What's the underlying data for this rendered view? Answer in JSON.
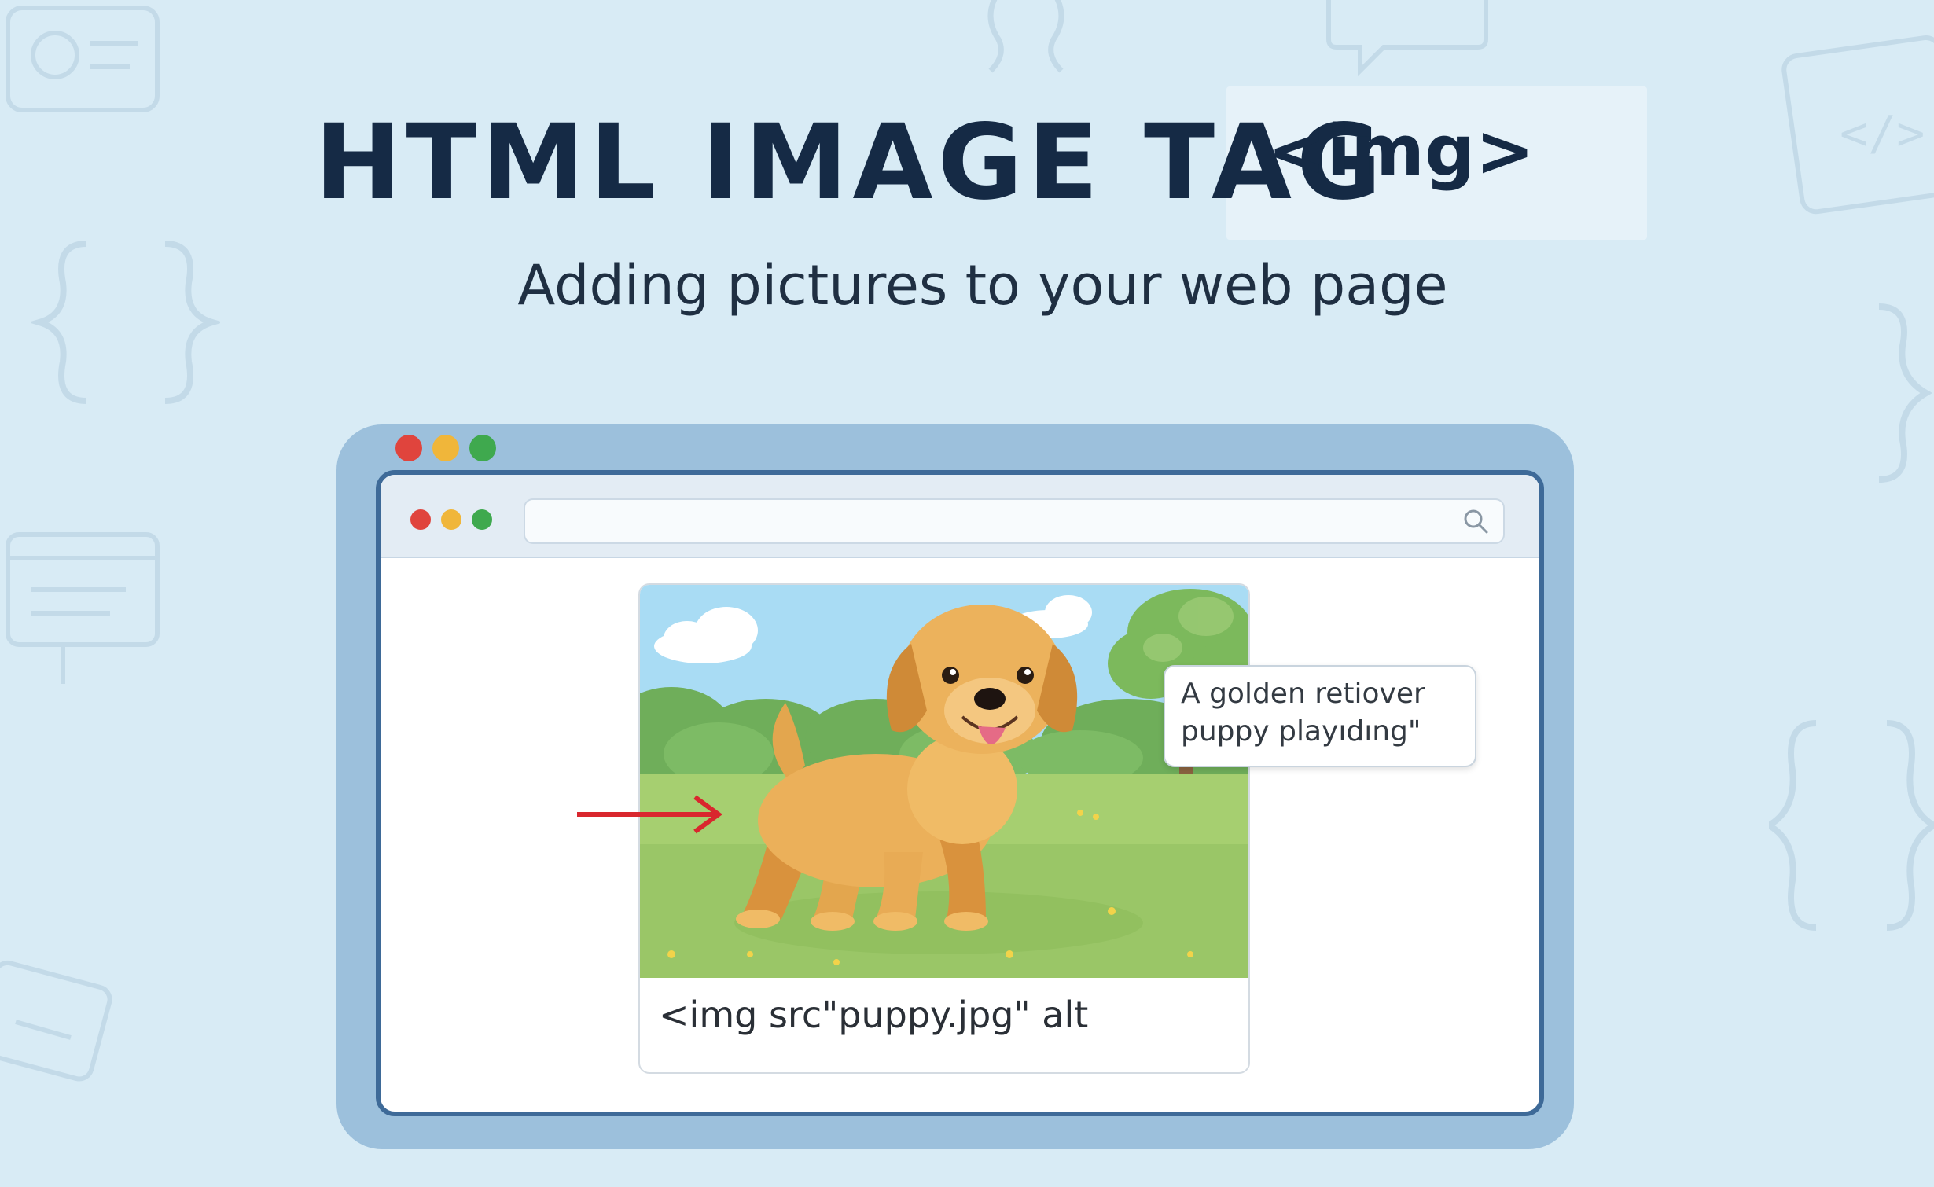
{
  "title": {
    "main": "HTML IMAGE TAG",
    "tag": "<img>"
  },
  "subtitle": "Adding pictures to your web page",
  "browser": {
    "window_controls": [
      "close",
      "minimize",
      "maximize"
    ],
    "search_icon": "search-icon",
    "image_description": "golden retriever puppy in a park illustration"
  },
  "code_caption": "<img src\"puppy.jpg\" alt",
  "alt_tooltip": {
    "line1": "A golden retiover",
    "line2": "puppy playıdıng\""
  },
  "colors": {
    "background": "#d8ebf5",
    "title": "#152a45",
    "frame": "#9cc0dc",
    "frame_border": "#3e6a98",
    "dot_red": "#e0443d",
    "dot_yellow": "#f0b63a",
    "dot_green": "#3fa94e",
    "arrow": "#d9272e"
  }
}
